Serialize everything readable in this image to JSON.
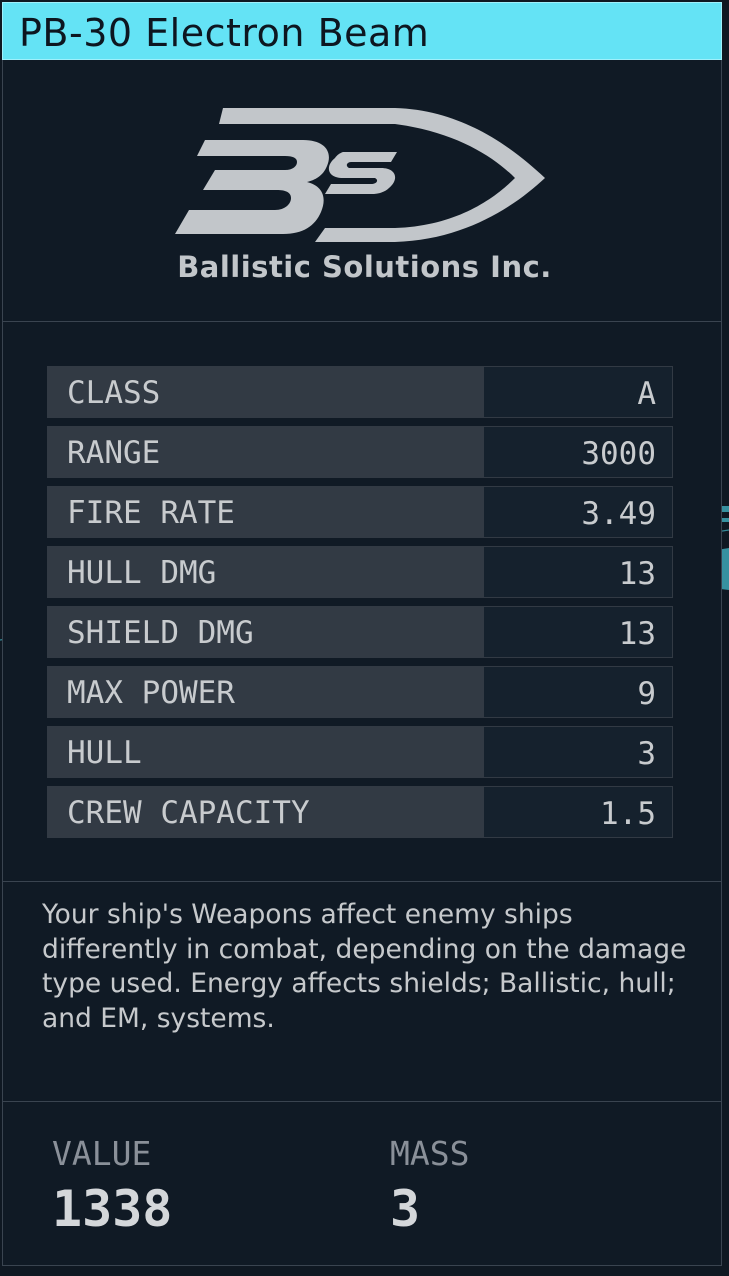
{
  "title": "PB-30 Electron Beam",
  "manufacturer": {
    "logo_icon": "ballistic-solutions-logo",
    "logo_text": "BS",
    "name": "Ballistic Solutions Inc."
  },
  "stats": [
    {
      "label": "CLASS",
      "value": "A"
    },
    {
      "label": "RANGE",
      "value": "3000"
    },
    {
      "label": "FIRE RATE",
      "value": "3.49"
    },
    {
      "label": "HULL DMG",
      "value": "13"
    },
    {
      "label": "SHIELD DMG",
      "value": "13"
    },
    {
      "label": "MAX POWER",
      "value": "9"
    },
    {
      "label": "HULL",
      "value": "3"
    },
    {
      "label": "CREW CAPACITY",
      "value": "1.5"
    }
  ],
  "description": "Your ship's Weapons affect enemy ships differently in combat, depending on the damage type used. Energy affects shields; Ballistic, hull; and EM, systems.",
  "footer": {
    "value_label": "VALUE",
    "value": "1338",
    "mass_label": "MASS",
    "mass": "3"
  },
  "colors": {
    "accent": "#64e3f5",
    "panel_bg": "#101a25",
    "row_label_bg": "#323a44",
    "text": "#c8cbce"
  }
}
